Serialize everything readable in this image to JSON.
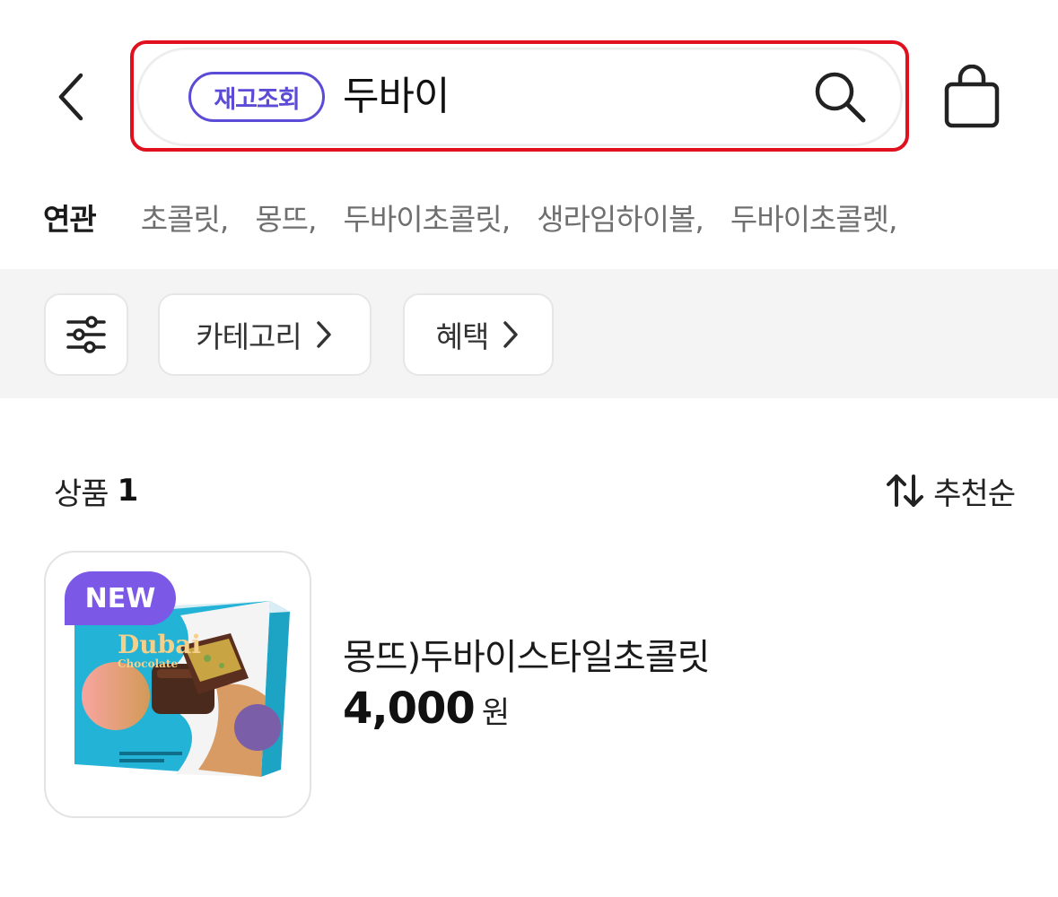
{
  "header": {
    "stock_badge": "재고조회",
    "search_query": "두바이"
  },
  "related": {
    "label": "연관",
    "keywords": [
      "초콜릿,",
      "몽뜨,",
      "두바이초콜릿,",
      "생라임하이볼,",
      "두바이초콜렛,"
    ]
  },
  "filters": {
    "category_label": "카테고리",
    "benefit_label": "혜택"
  },
  "list": {
    "count_label": "상품",
    "count_value": "1",
    "sort_label": "추천순"
  },
  "product": {
    "badge": "NEW",
    "name": "몽뜨)두바이스타일초콜릿",
    "price": "4,000",
    "price_unit": "원",
    "package_brand": "Dubai",
    "package_subtitle": "Chocolate"
  },
  "colors": {
    "accent_purple": "#5b4bd6",
    "new_badge": "#7b59e6",
    "highlight_red": "#e0101e"
  }
}
